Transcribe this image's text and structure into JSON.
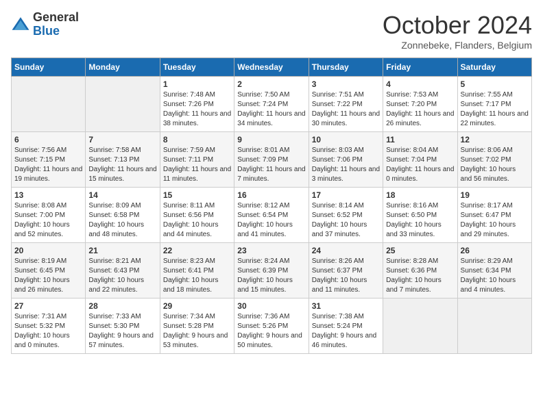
{
  "header": {
    "logo_general": "General",
    "logo_blue": "Blue",
    "month_title": "October 2024",
    "subtitle": "Zonnebeke, Flanders, Belgium"
  },
  "days_of_week": [
    "Sunday",
    "Monday",
    "Tuesday",
    "Wednesday",
    "Thursday",
    "Friday",
    "Saturday"
  ],
  "weeks": [
    [
      {
        "day": "",
        "empty": true
      },
      {
        "day": "",
        "empty": true
      },
      {
        "day": "1",
        "sunrise": "7:48 AM",
        "sunset": "7:26 PM",
        "daylight": "11 hours and 38 minutes."
      },
      {
        "day": "2",
        "sunrise": "7:50 AM",
        "sunset": "7:24 PM",
        "daylight": "11 hours and 34 minutes."
      },
      {
        "day": "3",
        "sunrise": "7:51 AM",
        "sunset": "7:22 PM",
        "daylight": "11 hours and 30 minutes."
      },
      {
        "day": "4",
        "sunrise": "7:53 AM",
        "sunset": "7:20 PM",
        "daylight": "11 hours and 26 minutes."
      },
      {
        "day": "5",
        "sunrise": "7:55 AM",
        "sunset": "7:17 PM",
        "daylight": "11 hours and 22 minutes."
      }
    ],
    [
      {
        "day": "6",
        "sunrise": "7:56 AM",
        "sunset": "7:15 PM",
        "daylight": "11 hours and 19 minutes."
      },
      {
        "day": "7",
        "sunrise": "7:58 AM",
        "sunset": "7:13 PM",
        "daylight": "11 hours and 15 minutes."
      },
      {
        "day": "8",
        "sunrise": "7:59 AM",
        "sunset": "7:11 PM",
        "daylight": "11 hours and 11 minutes."
      },
      {
        "day": "9",
        "sunrise": "8:01 AM",
        "sunset": "7:09 PM",
        "daylight": "11 hours and 7 minutes."
      },
      {
        "day": "10",
        "sunrise": "8:03 AM",
        "sunset": "7:06 PM",
        "daylight": "11 hours and 3 minutes."
      },
      {
        "day": "11",
        "sunrise": "8:04 AM",
        "sunset": "7:04 PM",
        "daylight": "11 hours and 0 minutes."
      },
      {
        "day": "12",
        "sunrise": "8:06 AM",
        "sunset": "7:02 PM",
        "daylight": "10 hours and 56 minutes."
      }
    ],
    [
      {
        "day": "13",
        "sunrise": "8:08 AM",
        "sunset": "7:00 PM",
        "daylight": "10 hours and 52 minutes."
      },
      {
        "day": "14",
        "sunrise": "8:09 AM",
        "sunset": "6:58 PM",
        "daylight": "10 hours and 48 minutes."
      },
      {
        "day": "15",
        "sunrise": "8:11 AM",
        "sunset": "6:56 PM",
        "daylight": "10 hours and 44 minutes."
      },
      {
        "day": "16",
        "sunrise": "8:12 AM",
        "sunset": "6:54 PM",
        "daylight": "10 hours and 41 minutes."
      },
      {
        "day": "17",
        "sunrise": "8:14 AM",
        "sunset": "6:52 PM",
        "daylight": "10 hours and 37 minutes."
      },
      {
        "day": "18",
        "sunrise": "8:16 AM",
        "sunset": "6:50 PM",
        "daylight": "10 hours and 33 minutes."
      },
      {
        "day": "19",
        "sunrise": "8:17 AM",
        "sunset": "6:47 PM",
        "daylight": "10 hours and 29 minutes."
      }
    ],
    [
      {
        "day": "20",
        "sunrise": "8:19 AM",
        "sunset": "6:45 PM",
        "daylight": "10 hours and 26 minutes."
      },
      {
        "day": "21",
        "sunrise": "8:21 AM",
        "sunset": "6:43 PM",
        "daylight": "10 hours and 22 minutes."
      },
      {
        "day": "22",
        "sunrise": "8:23 AM",
        "sunset": "6:41 PM",
        "daylight": "10 hours and 18 minutes."
      },
      {
        "day": "23",
        "sunrise": "8:24 AM",
        "sunset": "6:39 PM",
        "daylight": "10 hours and 15 minutes."
      },
      {
        "day": "24",
        "sunrise": "8:26 AM",
        "sunset": "6:37 PM",
        "daylight": "10 hours and 11 minutes."
      },
      {
        "day": "25",
        "sunrise": "8:28 AM",
        "sunset": "6:36 PM",
        "daylight": "10 hours and 7 minutes."
      },
      {
        "day": "26",
        "sunrise": "8:29 AM",
        "sunset": "6:34 PM",
        "daylight": "10 hours and 4 minutes."
      }
    ],
    [
      {
        "day": "27",
        "sunrise": "7:31 AM",
        "sunset": "5:32 PM",
        "daylight": "10 hours and 0 minutes."
      },
      {
        "day": "28",
        "sunrise": "7:33 AM",
        "sunset": "5:30 PM",
        "daylight": "9 hours and 57 minutes."
      },
      {
        "day": "29",
        "sunrise": "7:34 AM",
        "sunset": "5:28 PM",
        "daylight": "9 hours and 53 minutes."
      },
      {
        "day": "30",
        "sunrise": "7:36 AM",
        "sunset": "5:26 PM",
        "daylight": "9 hours and 50 minutes."
      },
      {
        "day": "31",
        "sunrise": "7:38 AM",
        "sunset": "5:24 PM",
        "daylight": "9 hours and 46 minutes."
      },
      {
        "day": "",
        "empty": true
      },
      {
        "day": "",
        "empty": true
      }
    ]
  ],
  "labels": {
    "sunrise": "Sunrise:",
    "sunset": "Sunset:",
    "daylight": "Daylight:"
  }
}
